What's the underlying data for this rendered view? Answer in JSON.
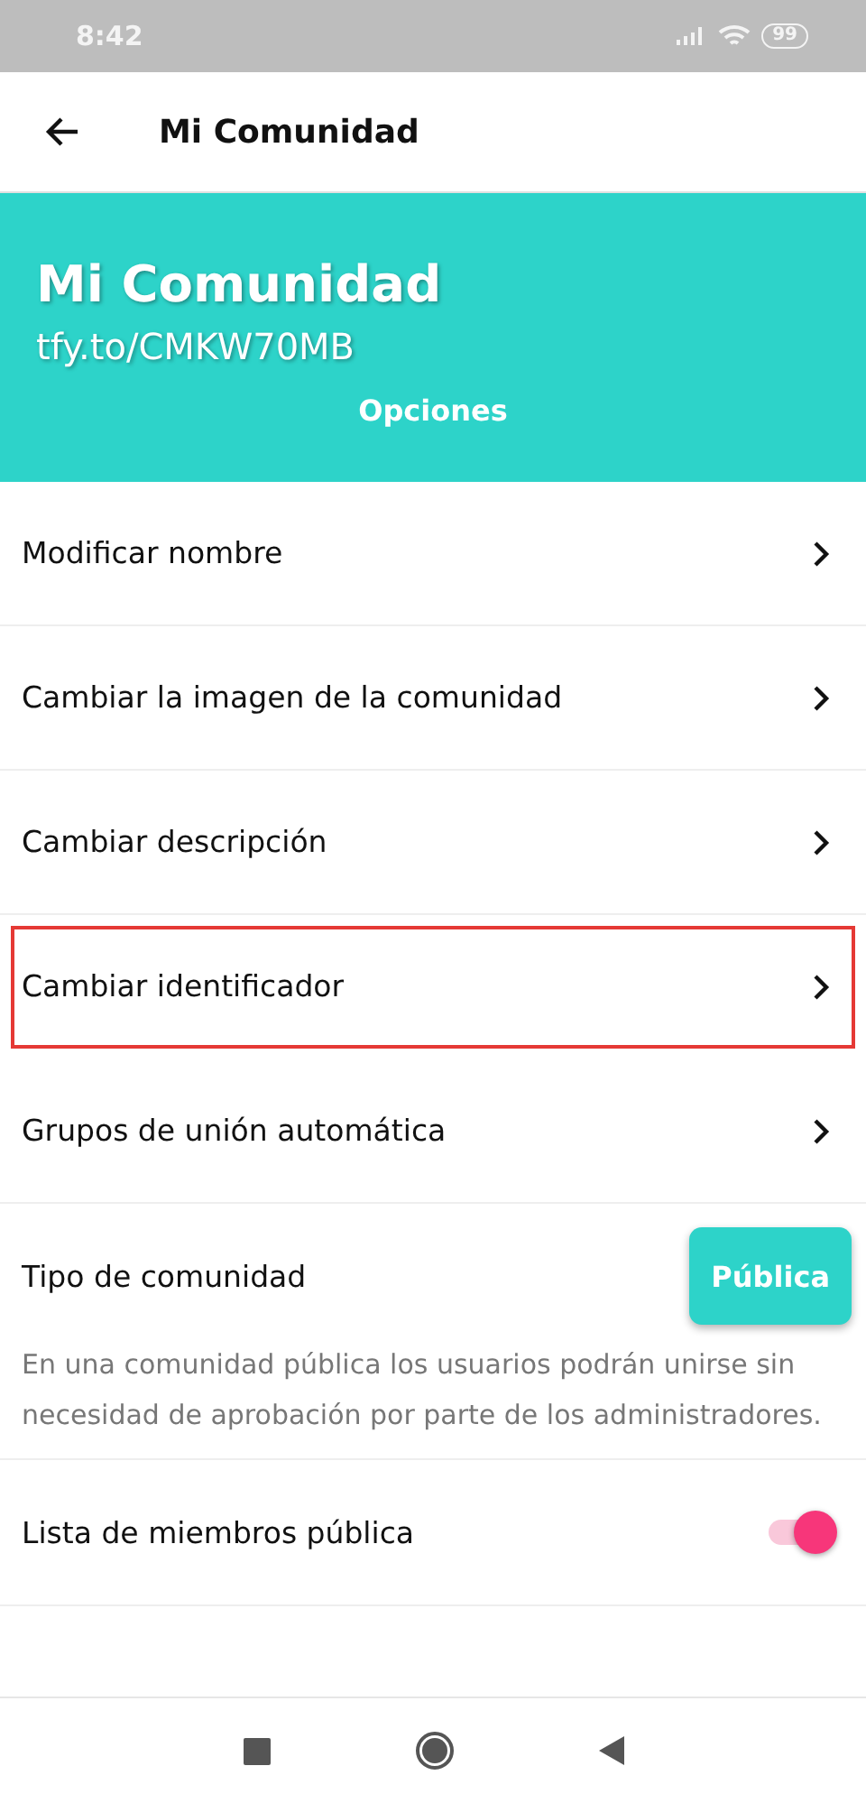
{
  "status_bar": {
    "time": "8:42",
    "battery": "99"
  },
  "app_bar": {
    "title": "Mi Comunidad"
  },
  "header": {
    "name": "Mi Comunidad",
    "link": "tfy.to/CMKW70MB",
    "section": "Opciones"
  },
  "menu_items": [
    {
      "label": "Modificar nombre",
      "highlighted": false
    },
    {
      "label": "Cambiar la imagen de la comunidad",
      "highlighted": false
    },
    {
      "label": "Cambiar descripción",
      "highlighted": false
    },
    {
      "label": "Cambiar identificador",
      "highlighted": true
    },
    {
      "label": "Grupos de unión automática",
      "highlighted": false
    }
  ],
  "community_type": {
    "label": "Tipo de comunidad",
    "button": "Pública",
    "description": "En una comunidad pública los usuarios podrán unirse sin necesidad de aprobación por parte de los administradores."
  },
  "public_members": {
    "label": "Lista de miembros pública",
    "on": true
  }
}
